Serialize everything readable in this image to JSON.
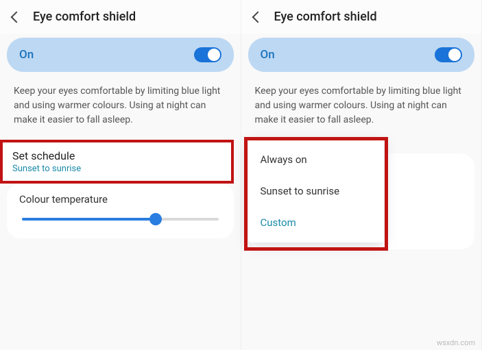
{
  "left": {
    "header_title": "Eye comfort shield",
    "on_label": "On",
    "desc": "Keep your eyes comfortable by limiting blue light and using warmer colours. Using at night can make it easier to fall asleep.",
    "schedule_title": "Set schedule",
    "schedule_value": "Sunset to sunrise",
    "colour_temp_label": "Colour temperature",
    "slider_percent": 68
  },
  "right": {
    "header_title": "Eye comfort shield",
    "on_label": "On",
    "desc": "Keep your eyes comfortable by limiting blue light and using warmer colours. Using at night can make it easier to fall asleep.",
    "options": {
      "always_on": "Always on",
      "sunset_sunrise": "Sunset to sunrise",
      "custom": "Custom"
    }
  },
  "watermark": "wsxdn.com"
}
